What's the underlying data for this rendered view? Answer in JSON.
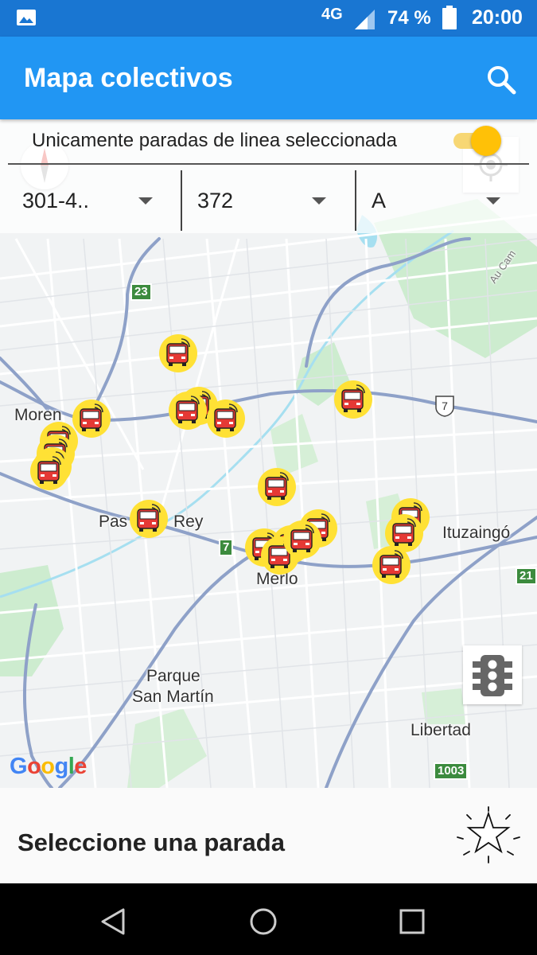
{
  "status_bar": {
    "network": "4G",
    "battery_percent": "74 %",
    "time": "20:00"
  },
  "app_bar": {
    "title": "Mapa colectivos",
    "search_icon": "search-icon"
  },
  "filter_panel": {
    "toggle_label": "Unicamente paradas de linea seleccionada",
    "toggle_on": true,
    "spinners": [
      {
        "value": "301-4.."
      },
      {
        "value": "372"
      },
      {
        "value": "A"
      }
    ]
  },
  "map": {
    "place_labels": {
      "moreno": "Moren",
      "paso_del_rey_a": "Pas",
      "paso_del_rey_b": "Rey",
      "merlo": "Merlo",
      "ituzaingo": "Ituzaingó",
      "parque_san_martin_1": "Parque",
      "parque_san_martin_2": "San Martín",
      "libertad": "Libertad",
      "road_label": "Au Cam"
    },
    "route_shields": {
      "r23": "23",
      "r7a": "7",
      "r7b": "7",
      "r21": "21",
      "r1003": "1003"
    },
    "bus_icon": "bus-icon",
    "bus_count": 20,
    "attribution": "Google",
    "colors": {
      "bus_marker": "#FFE135",
      "bus_body": "#E53935",
      "park": "#cdeccf",
      "water": "#a6dff0",
      "highway": "#8ea1c8"
    }
  },
  "bottom_sheet": {
    "message": "Seleccione una parada",
    "star_icon": "sparkle-star-icon"
  },
  "nav_bar": {
    "back_icon": "back-icon",
    "home_icon": "home-icon",
    "recents_icon": "recents-icon"
  }
}
